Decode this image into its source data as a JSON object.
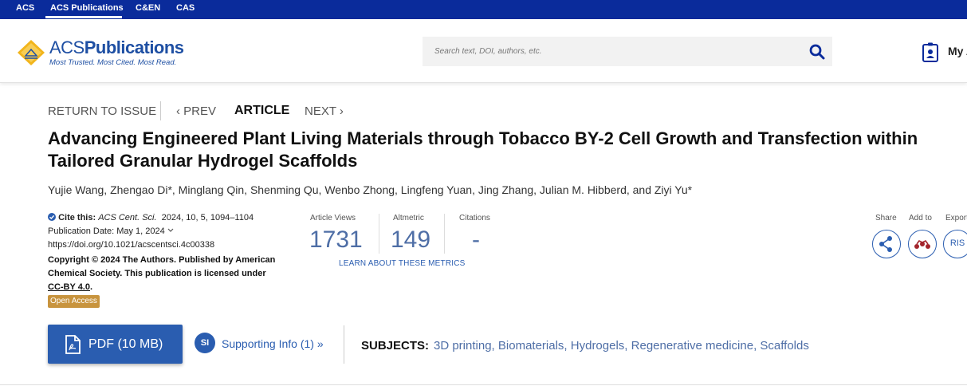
{
  "topbar": {
    "links": [
      "ACS",
      "ACS Publications",
      "C&EN",
      "CAS"
    ]
  },
  "brand": {
    "name_light": "ACS",
    "name_bold": "Publications",
    "tagline": "Most Trusted. Most Cited. Most Read."
  },
  "search": {
    "placeholder": "Search text, DOI, authors, etc."
  },
  "user": {
    "label": "My A"
  },
  "article_nav": {
    "return": "RETURN TO ISSUE",
    "prev": "‹ PREV",
    "current": "ARTICLE",
    "next": "NEXT ›"
  },
  "article": {
    "title": "Advancing Engineered Plant Living Materials through Tobacco BY-2 Cell Growth and Transfection within Tailored Granular Hydrogel Scaffolds",
    "authors": "Yujie Wang, Zhengao Di*, Minglang Qin, Shenming Qu, Wenbo Zhong, Lingfeng Yuan, Jing Zhang, Julian M. Hibberd, and Ziyi Yu*"
  },
  "meta": {
    "cite_label": "Cite this:",
    "journal": "ACS Cent. Sci.",
    "citation": "2024, 10, 5, 1094–1104",
    "pub_date": "Publication Date: May 1, 2024",
    "doi": "https://doi.org/10.1021/acscentsci.4c00338",
    "copyright": "Copyright © 2024 The Authors. Published by American Chemical Society. This publication is licensed under",
    "license": "CC-BY 4.0",
    "open_access": "Open Access"
  },
  "metrics": {
    "views_label": "Article Views",
    "views": "1731",
    "altmetric_label": "Altmetric",
    "altmetric": "149",
    "citations_label": "Citations",
    "citations": "-",
    "learn_more": "LEARN ABOUT THESE METRICS"
  },
  "tools": {
    "share": "Share",
    "add_to": "Add to",
    "export": "Export",
    "ris": "RIS"
  },
  "actions": {
    "pdf": "PDF (10 MB)",
    "si_badge": "SI",
    "supporting": "Supporting Info (1) »"
  },
  "subjects": {
    "label": "SUBJECTS:",
    "items": [
      "3D printing",
      "Biomaterials",
      "Hydrogels",
      "Regenerative medicine",
      "Scaffolds"
    ]
  },
  "colors": {
    "topbar": "#0a2b9b",
    "accent": "#2a5db0",
    "metric": "#4e6ea6",
    "open_access": "#c8943e"
  }
}
